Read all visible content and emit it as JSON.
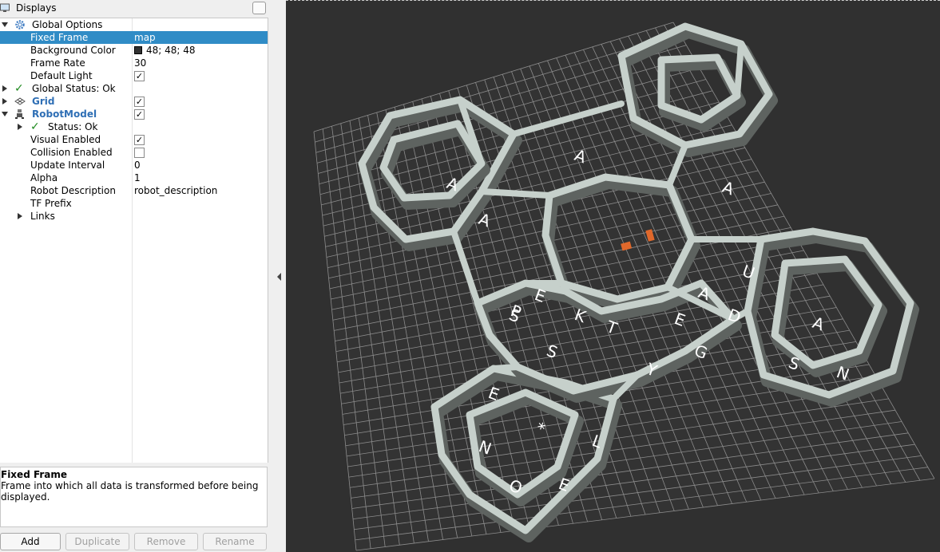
{
  "panel": {
    "title": "Displays"
  },
  "tree": {
    "global_options": {
      "label": "Global Options"
    },
    "fixed_frame": {
      "label": "Fixed Frame",
      "value": "map"
    },
    "background_color": {
      "label": "Background Color",
      "value": "48; 48; 48",
      "color": "#303030"
    },
    "frame_rate": {
      "label": "Frame Rate",
      "value": "30"
    },
    "default_light": {
      "label": "Default Light",
      "checked": true
    },
    "global_status": {
      "label": "Global Status: Ok"
    },
    "grid": {
      "label": "Grid",
      "checked": true
    },
    "robot_model": {
      "label": "RobotModel",
      "checked": true
    },
    "status": {
      "label": "Status: Ok"
    },
    "visual_enabled": {
      "label": "Visual Enabled",
      "checked": true
    },
    "collision_enabled": {
      "label": "Collision Enabled",
      "checked": false
    },
    "update_interval": {
      "label": "Update Interval",
      "value": "0"
    },
    "alpha": {
      "label": "Alpha",
      "value": "1"
    },
    "robot_description": {
      "label": "Robot Description",
      "value": "robot_description"
    },
    "tf_prefix": {
      "label": "TF Prefix",
      "value": ""
    },
    "links": {
      "label": "Links"
    }
  },
  "description": {
    "title": "Fixed Frame",
    "body": "Frame into which all data is transformed before being displayed."
  },
  "buttons": {
    "add": "Add",
    "duplicate": "Duplicate",
    "remove": "Remove",
    "rename": "Rename"
  },
  "viewport": {
    "background": "#303030",
    "grid_color": "#8c8c8c",
    "wall_color": "#c6d0cb",
    "wall_shadow": "#5e6360",
    "robot_color": "#e0682b",
    "letters": [
      "A",
      "A",
      "A",
      "E",
      "S",
      "T",
      "Y",
      "K",
      "U",
      "P",
      "S",
      "E",
      "G",
      "A",
      "D",
      "A",
      "S",
      "N",
      "A",
      "E",
      "N",
      "*",
      "L",
      "O",
      "E"
    ]
  },
  "icons": {
    "displays": "monitor-icon",
    "options": "gear-icon",
    "ok": "checkmark-icon",
    "grid": "grid-icon",
    "robot": "robot-icon"
  }
}
